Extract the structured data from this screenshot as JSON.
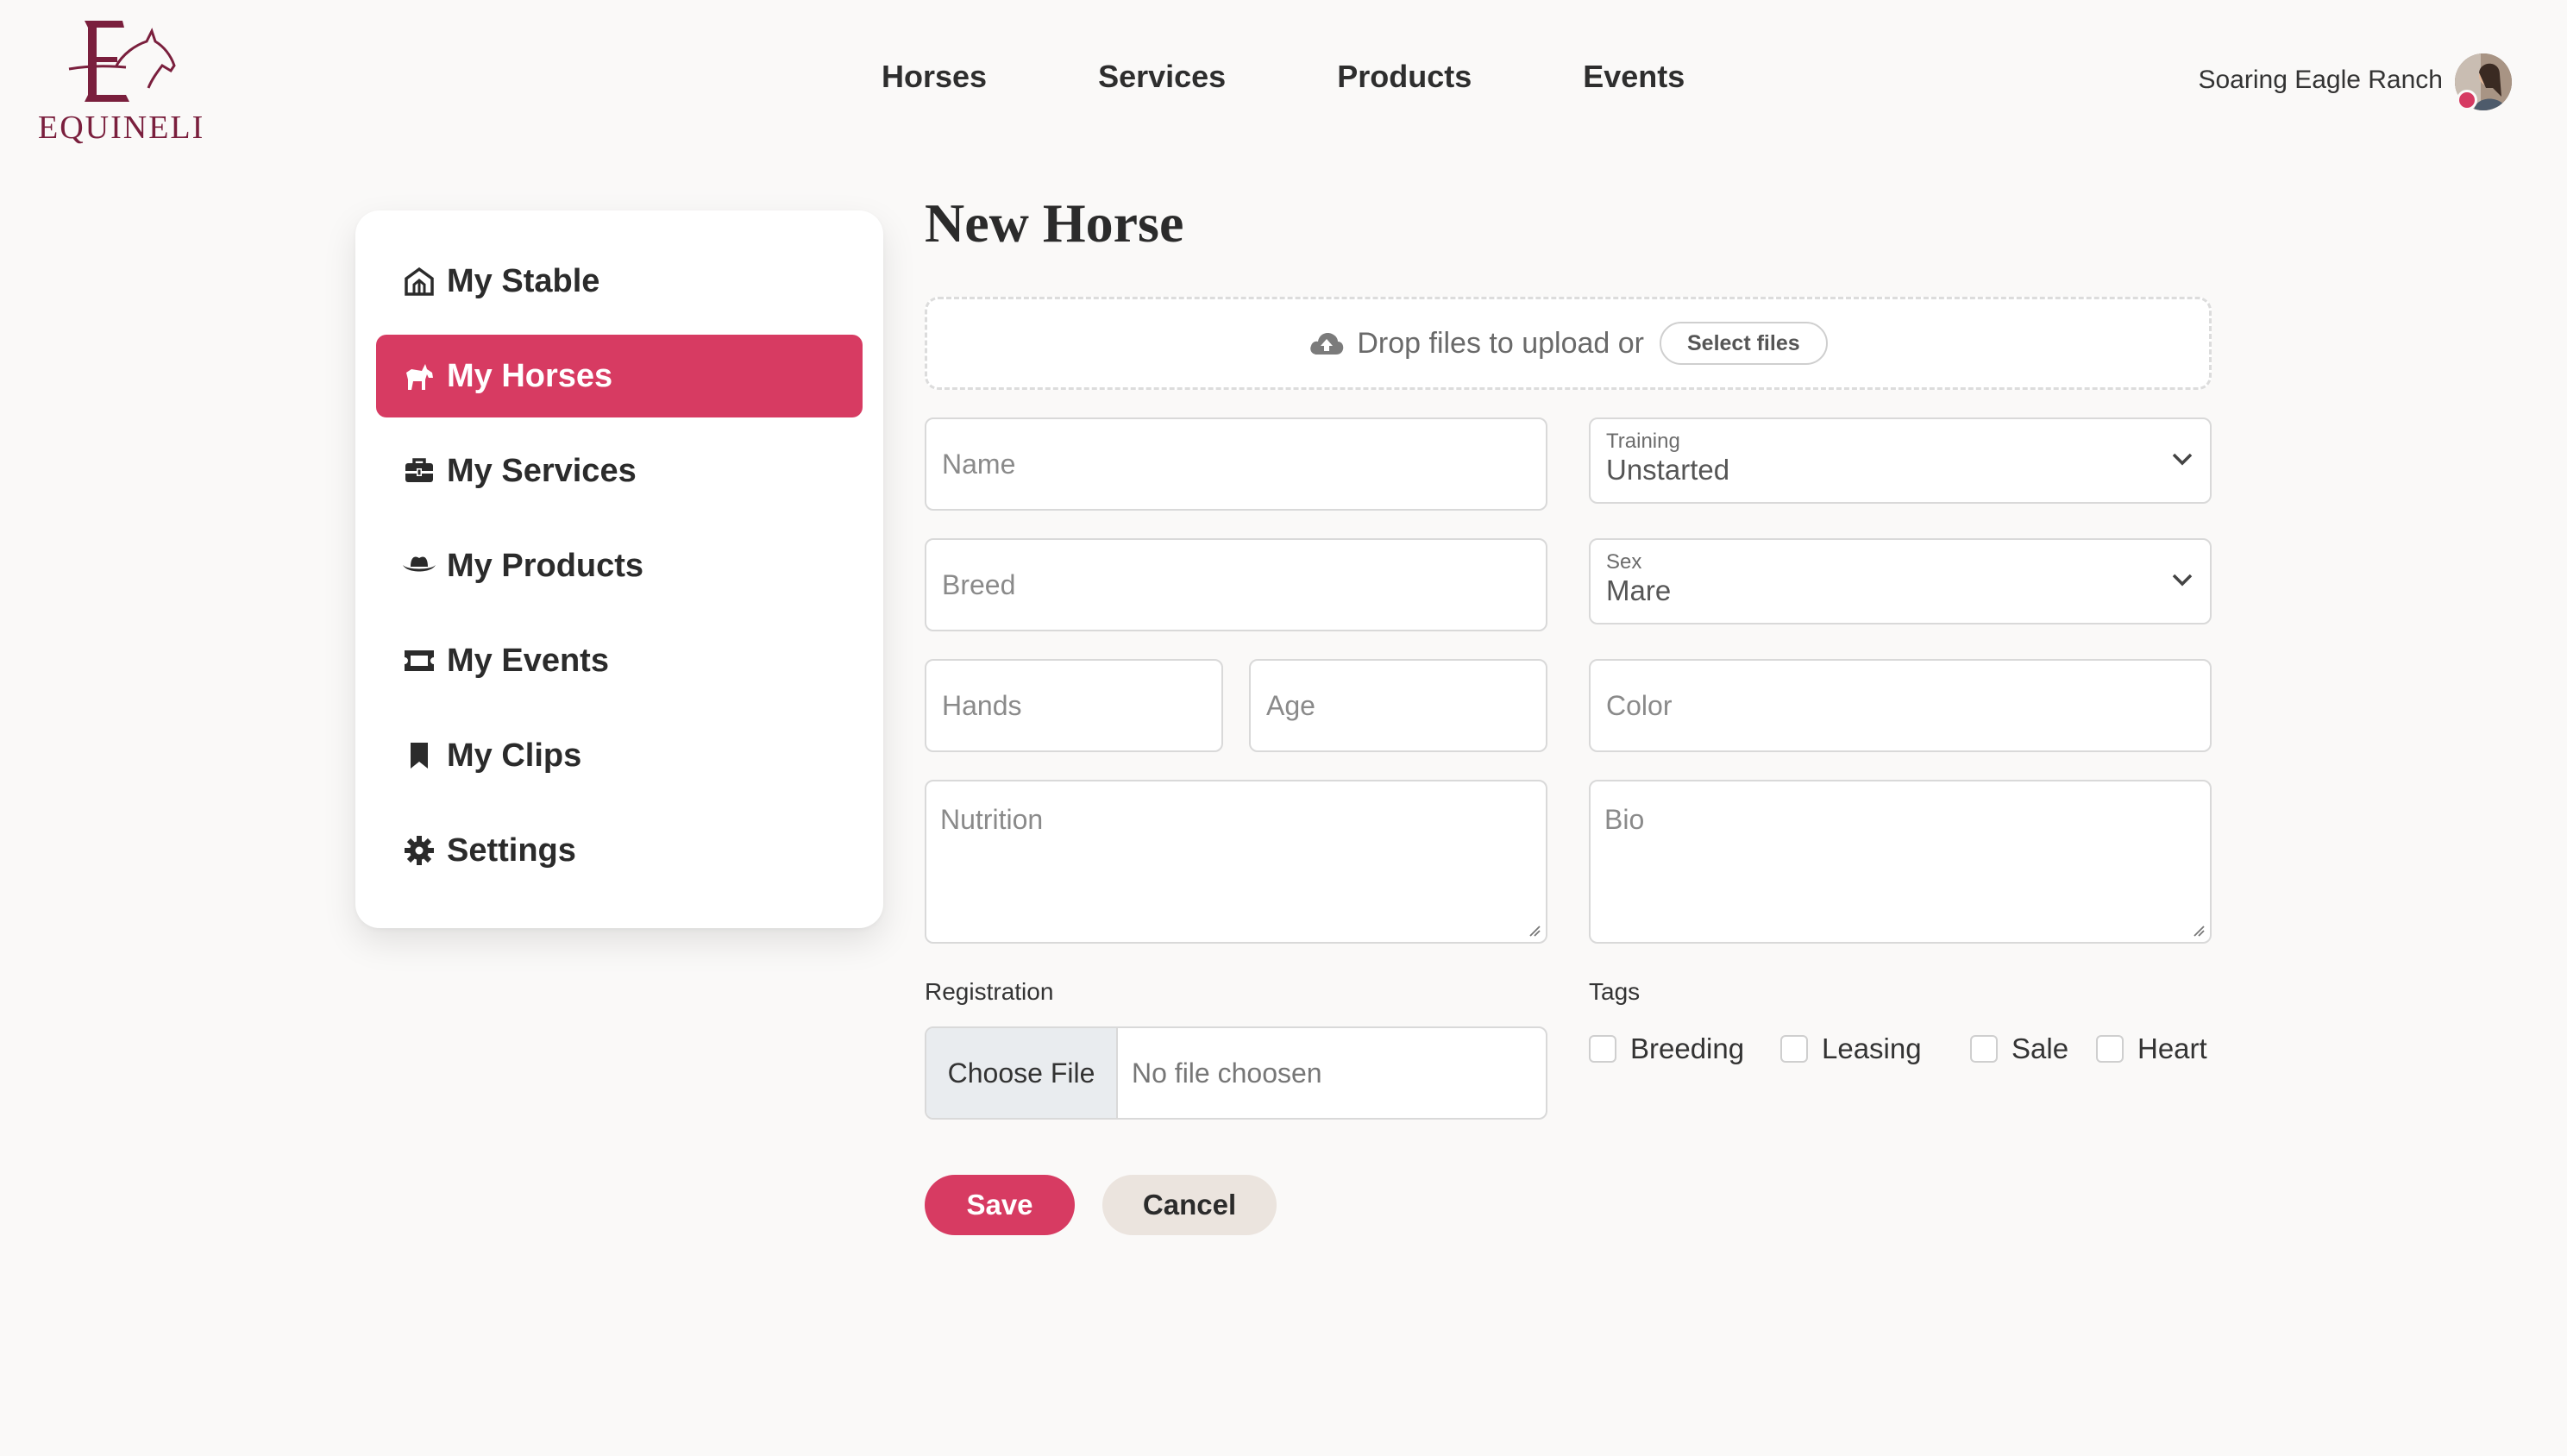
{
  "brand": {
    "logo_text": "EQUINELI",
    "accent_color": "#d73b62",
    "logo_color": "#7a1f3d"
  },
  "topnav": {
    "items": [
      {
        "label": "Horses"
      },
      {
        "label": "Services"
      },
      {
        "label": "Products"
      },
      {
        "label": "Events"
      }
    ]
  },
  "account": {
    "ranch_name": "Soaring Eagle Ranch",
    "avatar_icon": "user-avatar"
  },
  "sidebar": {
    "items": [
      {
        "label": "My Stable",
        "icon": "barn-icon",
        "active": false
      },
      {
        "label": "My Horses",
        "icon": "horse-icon",
        "active": true
      },
      {
        "label": "My Services",
        "icon": "toolbox-icon",
        "active": false
      },
      {
        "label": "My Products",
        "icon": "cowboy-hat-icon",
        "active": false
      },
      {
        "label": "My Events",
        "icon": "ticket-icon",
        "active": false
      },
      {
        "label": "My Clips",
        "icon": "bookmark-icon",
        "active": false
      },
      {
        "label": "Settings",
        "icon": "gear-icon",
        "active": false
      }
    ]
  },
  "main": {
    "title": "New Horse",
    "upload": {
      "text": "Drop files to upload or",
      "button": "Select files",
      "icon": "cloud-upload-icon"
    },
    "fields": {
      "name": {
        "placeholder": "Name",
        "value": ""
      },
      "breed": {
        "placeholder": "Breed",
        "value": ""
      },
      "hands": {
        "placeholder": "Hands",
        "value": ""
      },
      "age": {
        "placeholder": "Age",
        "value": ""
      },
      "color": {
        "placeholder": "Color",
        "value": ""
      },
      "nutrition": {
        "placeholder": "Nutrition",
        "value": ""
      },
      "bio": {
        "placeholder": "Bio",
        "value": ""
      }
    },
    "training": {
      "label": "Training",
      "value": "Unstarted"
    },
    "sex": {
      "label": "Sex",
      "value": "Mare"
    },
    "registration": {
      "label": "Registration",
      "button": "Choose File",
      "status": "No file choosen"
    },
    "tags": {
      "label": "Tags",
      "items": [
        {
          "label": "Breeding",
          "checked": false
        },
        {
          "label": "Leasing",
          "checked": false
        },
        {
          "label": "Sale",
          "checked": false
        },
        {
          "label": "Heart",
          "checked": false
        }
      ]
    },
    "actions": {
      "save": "Save",
      "cancel": "Cancel"
    }
  }
}
